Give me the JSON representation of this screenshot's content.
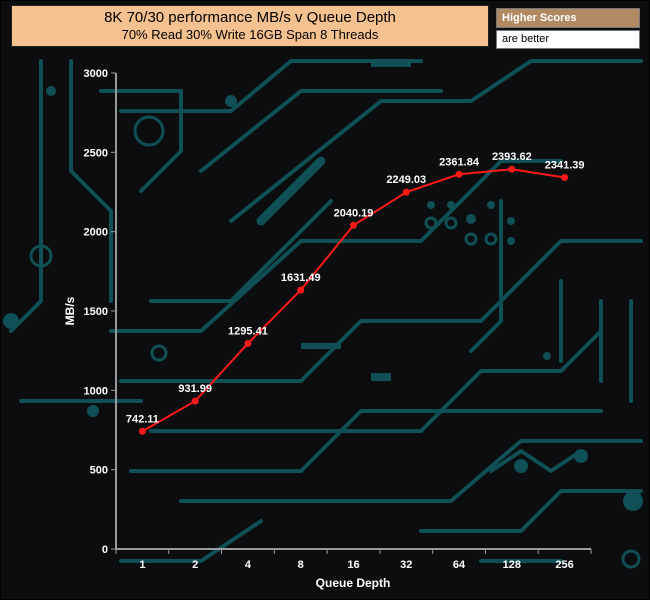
{
  "chart_data": {
    "type": "line",
    "title": "8K 70/30 performance MB/s v Queue Depth",
    "subtitle": "70% Read 30% Write 16GB Span 8 Threads",
    "xlabel": "Queue Depth",
    "ylabel": "MB/s",
    "categories": [
      "1",
      "2",
      "4",
      "8",
      "16",
      "32",
      "64",
      "128",
      "256"
    ],
    "values": [
      742.11,
      931.99,
      1295.41,
      1631.49,
      2040.19,
      2249.03,
      2361.84,
      2393.62,
      2341.39
    ],
    "data_labels": [
      "742.11",
      "931.99",
      "1295.41",
      "1631.49",
      "2040.19",
      "2249.03",
      "2361.84",
      "2393.62",
      "2341.39"
    ],
    "ylim": [
      0,
      3000
    ],
    "yticks": [
      0,
      500,
      1000,
      1500,
      2000,
      2500,
      3000
    ],
    "grid": false,
    "line_color": "#ff1a1a",
    "background_color": "#0b0d0e",
    "trace_color": "#0f4f55"
  },
  "legend_note": {
    "line1": "Higher Scores",
    "line2": "are better"
  }
}
